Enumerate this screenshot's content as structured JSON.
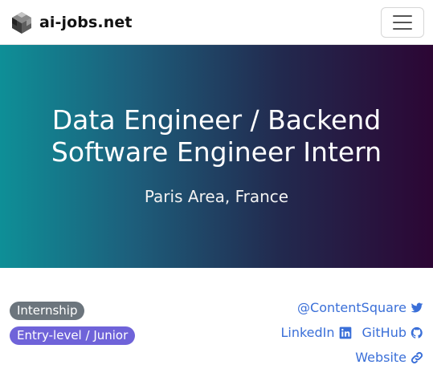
{
  "navbar": {
    "brand_text": "ai-jobs.net",
    "logo_icon": "cube-logo-icon",
    "menu_icon": "hamburger-menu-icon"
  },
  "hero": {
    "title": "Data Engineer / Backend Software Engineer Intern",
    "location": "Paris Area, France",
    "gradient_colors": [
      "#0e8f97",
      "#1d5f7c",
      "#22294e",
      "#2c0634"
    ]
  },
  "tags": {
    "employment_type": "Internship",
    "experience_level": "Entry-level / Junior",
    "employment_type_color": "#6c757d",
    "experience_level_color": "#6f63d9"
  },
  "company_links": {
    "twitter_handle": "@ContentSquare",
    "twitter_icon": "twitter-icon",
    "linkedin_label": "LinkedIn",
    "linkedin_icon": "linkedin-icon",
    "github_label": "GitHub",
    "github_icon": "github-icon",
    "website_label": "Website",
    "website_icon": "link-icon",
    "link_color": "#3a6fd8"
  }
}
